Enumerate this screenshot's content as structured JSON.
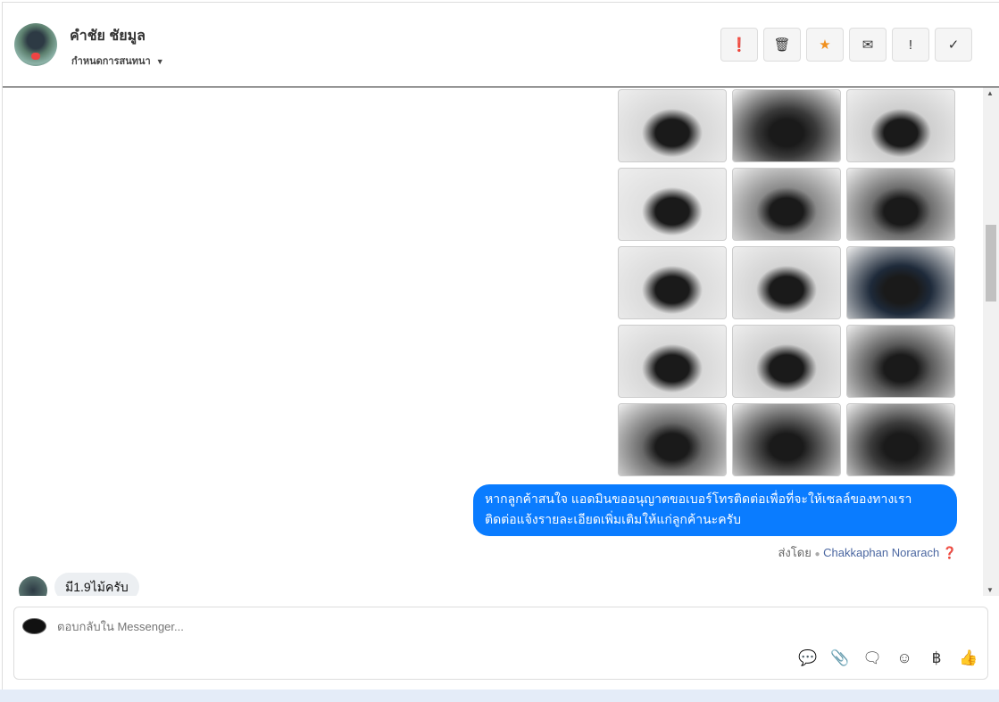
{
  "header": {
    "contact_name": "คำชัย ชัยมูล",
    "assign_label": "กำหนดการสนทนา",
    "actions": [
      {
        "name": "spam",
        "glyph": "❗"
      },
      {
        "name": "delete",
        "glyph": "🗑"
      },
      {
        "name": "star",
        "glyph": "★"
      },
      {
        "name": "mail",
        "glyph": "✉"
      },
      {
        "name": "priority",
        "glyph": "!"
      },
      {
        "name": "done",
        "glyph": "✓"
      }
    ]
  },
  "chat": {
    "photos": 15,
    "outgoing_message": "หากลูกค้าสนใจ แอดมินขออนุญาตขอเบอร์โทรติดต่อเพื่อที่จะให้เซลล์ของทางเรา ติดต่อแจ้งรายละเอียดเพิ่มเติมให้แก่ลูกค้านะครับ",
    "sent_by_label": "ส่งโดย",
    "sent_by_name": "Chakkaphan Norarach",
    "incoming_message": "มี1.9ไม้ครับ"
  },
  "composer": {
    "placeholder": "ตอบกลับใน Messenger...",
    "currency_glyph": "฿"
  },
  "colors": {
    "accent": "#0a7cff",
    "star": "#f0901e"
  }
}
